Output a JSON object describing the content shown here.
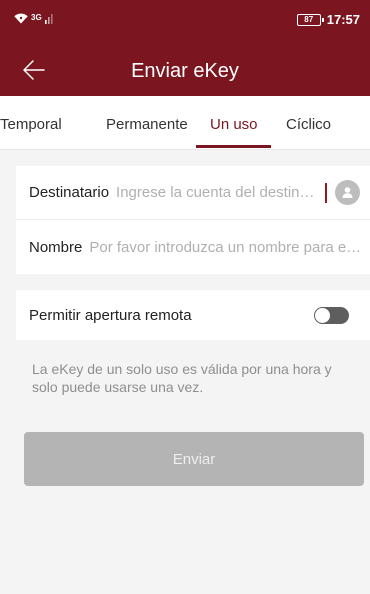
{
  "status_bar": {
    "network": "3G",
    "battery": "87",
    "time": "17:57"
  },
  "app_bar": {
    "title": "Enviar eKey",
    "back_icon": "arrow-left-icon"
  },
  "tabs": [
    {
      "label": "Temporal",
      "active": false
    },
    {
      "label": "Permanente",
      "active": false
    },
    {
      "label": "Un uso",
      "active": true
    },
    {
      "label": "Cíclico",
      "active": false
    }
  ],
  "form": {
    "recipient": {
      "label": "Destinatario",
      "placeholder": "Ingrese la cuenta del destinatario",
      "value": "",
      "contact_icon": "person-icon"
    },
    "name": {
      "label": "Nombre",
      "placeholder": "Por favor introduzca un nombre para esta eKey",
      "value": ""
    }
  },
  "remote_unlock": {
    "label": "Permitir apertura remota",
    "enabled": false
  },
  "info_text": "La eKey de un solo uso es válida por una hora y solo puede usarse una vez.",
  "send_button": {
    "label": "Enviar",
    "enabled": false
  },
  "colors": {
    "brand": "#7b1620",
    "background": "#f4f4f4",
    "disabled_button": "#b4b4b4",
    "placeholder": "#b0b0b0"
  }
}
